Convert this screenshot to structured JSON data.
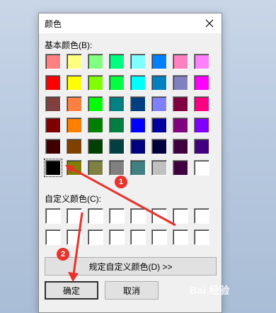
{
  "dialog": {
    "title": "颜色",
    "basic_colors_label": "基本颜色(B):",
    "custom_colors_label": "自定义颜色(C):",
    "define_custom_button": "规定自定义颜色(D) >>",
    "ok_button": "确定",
    "cancel_button": "取消",
    "basic_colors": [
      "#ff8080",
      "#ffff80",
      "#80ff80",
      "#00ff80",
      "#80ffff",
      "#0080ff",
      "#ff80c0",
      "#ff80ff",
      "#ff0000",
      "#ffff00",
      "#80ff00",
      "#00ff40",
      "#00ffff",
      "#0080c0",
      "#8080c0",
      "#ff00ff",
      "#804040",
      "#ff8040",
      "#00ff00",
      "#008080",
      "#004080",
      "#8080ff",
      "#800040",
      "#ff0080",
      "#800000",
      "#ff8000",
      "#008000",
      "#008040",
      "#0000ff",
      "#0000a0",
      "#800080",
      "#8000ff",
      "#400000",
      "#804000",
      "#004000",
      "#004040",
      "#000080",
      "#000040",
      "#400040",
      "#400080",
      "#000000",
      "#808000",
      "#808040",
      "#808080",
      "#408080",
      "#c0c0c0",
      "#400040",
      "#ffffff"
    ],
    "selected_index": 40,
    "custom_colors": [
      "#ffffff",
      "#ffffff",
      "#ffffff",
      "#ffffff",
      "#ffffff",
      "#ffffff",
      "#ffffff",
      "#ffffff",
      "#ffffff",
      "#ffffff",
      "#ffffff",
      "#ffffff",
      "#ffffff",
      "#ffffff",
      "#ffffff",
      "#ffffff"
    ]
  },
  "annotations": {
    "badge_1": "1",
    "badge_2": "2",
    "arrow_color": "#e8322b"
  },
  "watermark": "Bai 经验"
}
